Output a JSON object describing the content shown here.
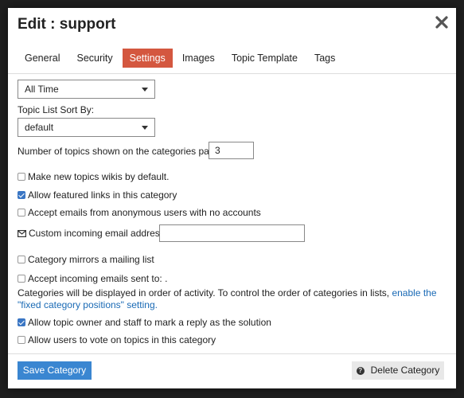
{
  "modal": {
    "title": "Edit : support",
    "close_icon": "close-icon"
  },
  "tabs": [
    {
      "label": "General",
      "active": false
    },
    {
      "label": "Security",
      "active": false
    },
    {
      "label": "Settings",
      "active": true
    },
    {
      "label": "Images",
      "active": false
    },
    {
      "label": "Topic Template",
      "active": false
    },
    {
      "label": "Tags",
      "active": false
    }
  ],
  "settings": {
    "period_select": {
      "value": "All Time"
    },
    "sort_label": "Topic List Sort By:",
    "sort_select": {
      "value": "default"
    },
    "num_topics_label": "Number of topics shown on the categories page:",
    "num_topics_value": "3",
    "checkboxes": [
      {
        "label": "Make new topics wikis by default.",
        "checked": false
      },
      {
        "label": "Allow featured links in this category",
        "checked": true
      },
      {
        "label": "Accept emails from anonymous users with no accounts",
        "checked": false
      }
    ],
    "email_label": "Custom incoming email address:",
    "email_value": "",
    "mirrors_label": "Category mirrors a mailing list",
    "mirrors_checked": false,
    "incoming_label": "Accept incoming emails sent to: .",
    "incoming_checked": false,
    "order_text": "Categories will be displayed in order of activity. To control the order of categories in lists, ",
    "order_link": "enable the \"fixed category positions\" setting.",
    "solution_label": "Allow topic owner and staff to mark a reply as the solution",
    "solution_checked": true,
    "vote_label": "Allow users to vote on topics in this category",
    "vote_checked": false
  },
  "footer": {
    "save_label": "Save Category",
    "delete_label": "Delete Category",
    "delete_icon": "question-circle-icon"
  },
  "colors": {
    "active_tab": "#d4573f",
    "save_button": "#3a86d1",
    "link": "#1a6ab5",
    "checkbox_checked": "#3a76c4"
  }
}
